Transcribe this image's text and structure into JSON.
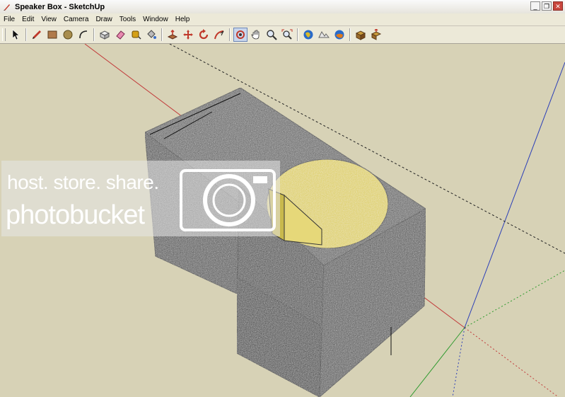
{
  "window": {
    "title": "Speaker Box - SketchUp",
    "controls": [
      "minimize-icon",
      "restore-icon",
      "close-icon"
    ]
  },
  "menu": [
    "File",
    "Edit",
    "View",
    "Camera",
    "Draw",
    "Tools",
    "Window",
    "Help"
  ],
  "toolbar": {
    "tools": [
      "select-icon",
      "pencil-icon",
      "rectangle-icon",
      "circle-icon",
      "arc-icon",
      "make-component-icon",
      "eraser-icon",
      "tape-measure-icon",
      "paint-bucket-icon",
      "push-pull-icon",
      "move-icon",
      "rotate-icon",
      "follow-me-icon",
      "orbit-icon",
      "pan-icon",
      "zoom-icon",
      "zoom-extents-icon",
      "add-location-icon",
      "toggle-terrain-icon",
      "preview-google-earth-icon",
      "get-models-icon",
      "share-model-icon"
    ],
    "active_tool": "orbit-icon"
  },
  "watermark": {
    "line1": "host. store. share.",
    "line2": "photobucket"
  },
  "colors": {
    "viewport_bg": "#d7d2b6",
    "box_face": "#3e3e3e",
    "port_fill": "#dccd58",
    "axis_red": "#c23a3a",
    "axis_blue": "#2b3fb8",
    "axis_green": "#2e9a2e"
  }
}
